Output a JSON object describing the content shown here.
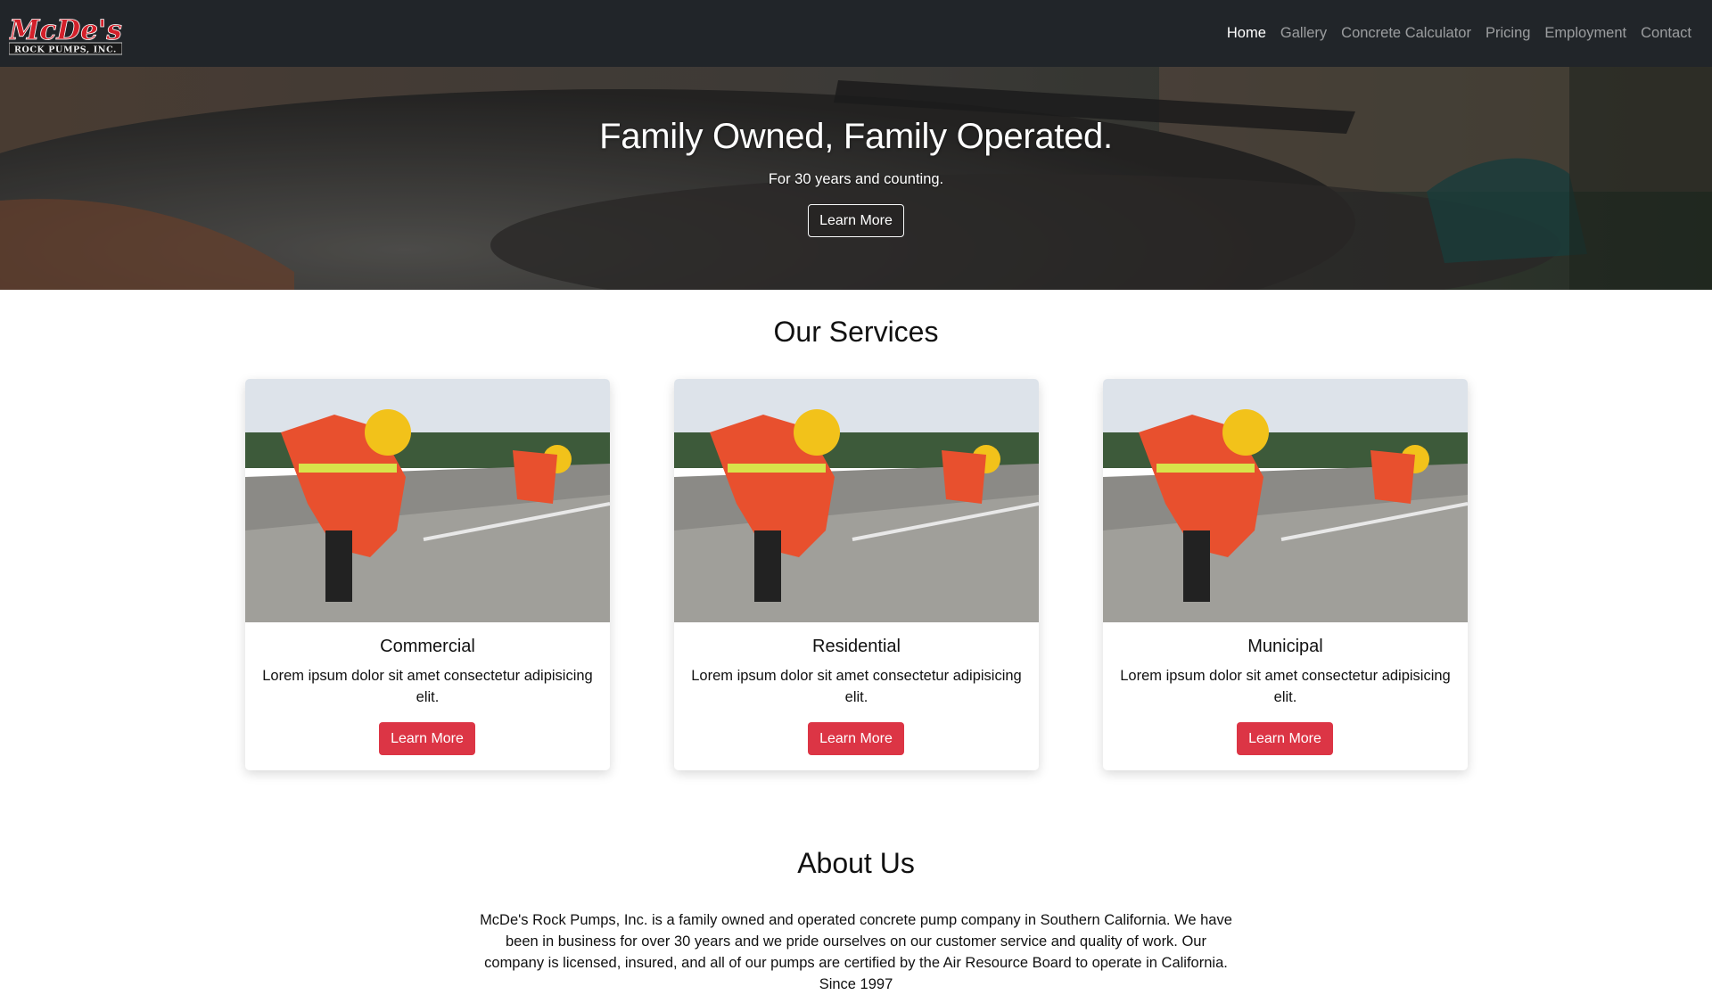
{
  "nav": {
    "logo_text_main": "McDe's",
    "logo_text_sub": "ROCK PUMPS, INC.",
    "links": [
      {
        "label": "Home",
        "active": true
      },
      {
        "label": "Gallery",
        "active": false
      },
      {
        "label": "Concrete Calculator",
        "active": false
      },
      {
        "label": "Pricing",
        "active": false
      },
      {
        "label": "Employment",
        "active": false
      },
      {
        "label": "Contact",
        "active": false
      }
    ]
  },
  "hero": {
    "title": "Family Owned, Family Operated.",
    "subtitle": "For 30 years and counting.",
    "button_label": "Learn More"
  },
  "services": {
    "title": "Our Services",
    "cards": [
      {
        "title": "Commercial",
        "text": "Lorem ipsum dolor sit amet consectetur adipisicing elit.",
        "button_label": "Learn More"
      },
      {
        "title": "Residential",
        "text": "Lorem ipsum dolor sit amet consectetur adipisicing elit.",
        "button_label": "Learn More"
      },
      {
        "title": "Municipal",
        "text": "Lorem ipsum dolor sit amet consectetur adipisicing elit.",
        "button_label": "Learn More"
      }
    ]
  },
  "about": {
    "title": "About Us",
    "text": "McDe's Rock Pumps, Inc. is a family owned and operated concrete pump company in Southern California. We have been in business for over 30 years and we pride ourselves on our customer service and quality of work. Our company is licensed, insured, and all of our pumps are certified by the Air Resource Board to operate in California. Since 1997"
  },
  "colors": {
    "navbar_bg": "#212529",
    "accent_red": "#dc3545"
  }
}
